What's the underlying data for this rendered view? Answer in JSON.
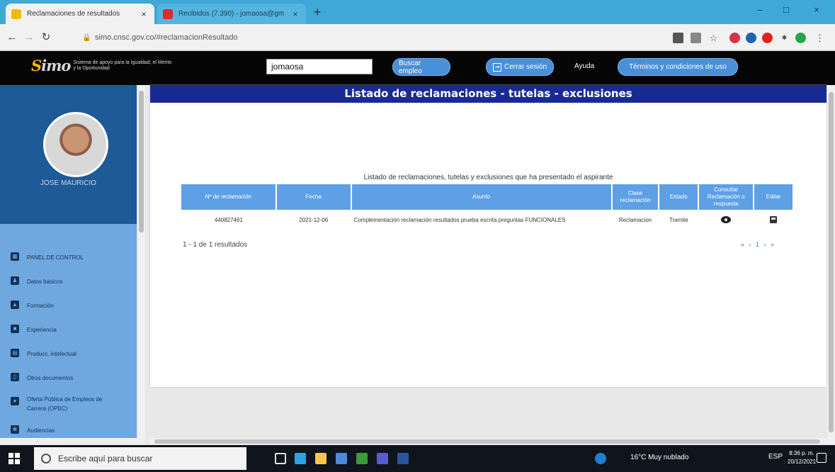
{
  "browser": {
    "tabs": [
      {
        "title": "Reclamaciones de resultados",
        "close": "×"
      },
      {
        "title": "Recibidos (7.390) - jomaosa@gm",
        "close": "×"
      }
    ],
    "new_tab": "+",
    "window_controls": {
      "minimize": "–",
      "maximize": "□",
      "close": "×"
    },
    "url": "simo.cnsc.gov.co/#reclamacionResultado"
  },
  "header": {
    "logo_text_left": "S",
    "logo_text_right": "imo",
    "logo_tagline": "Sistema de apoyo para la Igualdad, el Mérito y la Oportunidad",
    "search_value": "jomaosa",
    "buscar_empleo": "Buscar empleo",
    "cerrar_sesion": "Cerrar sesión",
    "ayuda": "Ayuda",
    "terminos": "Términos y condiciones de uso"
  },
  "sidebar": {
    "user_name": "JOSE MAURICIO",
    "items": [
      {
        "label": "PANEL DE CONTROL"
      },
      {
        "label": "Datos básicos"
      },
      {
        "label": "Formación"
      },
      {
        "label": "Experiencia"
      },
      {
        "label": "Producc. intelectual"
      },
      {
        "label": "Otros documentos"
      },
      {
        "label": "Oferta Pública de Empleos de Carrera (OPEC)"
      },
      {
        "label": "Audiencias"
      }
    ]
  },
  "main": {
    "title": "Listado de reclamaciones - tutelas - exclusiones",
    "caption": "Listado de reclamaciones, tutelas y exclusiones que ha presentado el aspirante",
    "columns": [
      "Nº de reclamación",
      "Fecha",
      "Asunto",
      "Clase reclamación",
      "Estado",
      "Consultar Reclamación o respuesta",
      "Editar"
    ],
    "rows": [
      {
        "numero": "440827461",
        "fecha": "2021-12-06",
        "asunto": "Complementación reclamación resultados prueba escrita preguntas FUNCIONALES",
        "clase": "Reclamacion",
        "estado": "Tramite"
      }
    ],
    "results_text": "1 - 1 de 1 resultados",
    "pager": "« ‹ 1 › »"
  },
  "taskbar": {
    "search_placeholder": "Escribe aquí para buscar",
    "weather": "16°C Muy nublado",
    "language": "ESP",
    "time": "8:36 p. m.",
    "date": "20/12/2021"
  },
  "colors": {
    "accent": "#1a2a95",
    "table_header": "#5ea0e6",
    "sidebar_dark": "#1f5f9e",
    "sidebar_light": "#6ea8df"
  }
}
